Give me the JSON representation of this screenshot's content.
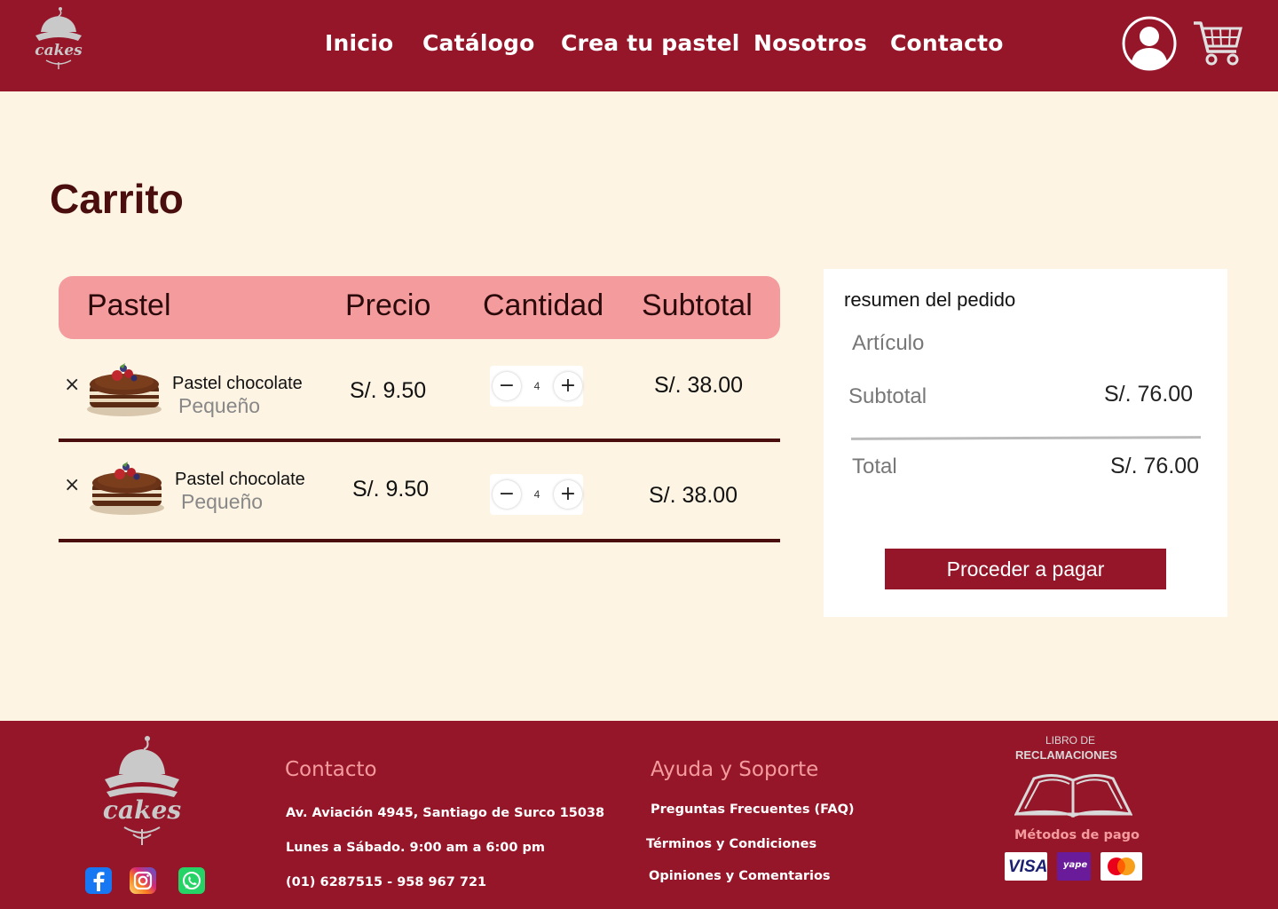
{
  "brand": {
    "logo_text": "cakes"
  },
  "nav": {
    "items": [
      {
        "label": "Inicio"
      },
      {
        "label": "Catálogo"
      },
      {
        "label": "Crea tu pastel"
      },
      {
        "label": "Nosotros"
      },
      {
        "label": "Contacto"
      }
    ]
  },
  "page": {
    "title": "Carrito"
  },
  "cart": {
    "columns": [
      "Pastel",
      "Precio",
      "Cantidad",
      "Subtotal"
    ],
    "items": [
      {
        "name": "Pastel chocolate",
        "size": "Pequeño",
        "price": "S/. 9.50",
        "quantity": "4",
        "subtotal": "S/. 38.00",
        "remove": "×"
      },
      {
        "name": "Pastel chocolate",
        "size": "Pequeño",
        "price": "S/. 9.50",
        "quantity": "4",
        "subtotal": "S/. 38.00",
        "remove": "×"
      }
    ],
    "minus": "−",
    "plus": "+"
  },
  "summary": {
    "title": "resumen del pedido",
    "article_label": "Artículo",
    "subtotal_label": "Subtotal",
    "subtotal_value": "S/. 76.00",
    "total_label": "Total",
    "total_value": "S/. 76.00",
    "checkout_label": "Proceder a pagar"
  },
  "footer": {
    "contact": {
      "heading": "Contacto",
      "address": "Av. Aviación 4945, Santiago de Surco 15038",
      "hours": "Lunes a Sábado. 9:00 am a 6:00 pm",
      "phones": "(01) 6287515 - 958 967 721"
    },
    "support": {
      "heading": "Ayuda y Soporte",
      "links": [
        "Preguntas Frecuentes (FAQ)",
        "Términos y Condiciones",
        "Opiniones y Comentarios"
      ]
    },
    "libro": {
      "line1": "LIBRO DE",
      "line2": "RECLAMACIONES"
    },
    "payments": {
      "label": "Métodos de pago",
      "visa": "VISA",
      "yape": "yape"
    },
    "social": [
      "facebook-icon",
      "instagram-icon",
      "whatsapp-icon"
    ]
  },
  "colors": {
    "primary": "#951529",
    "accent": "#f49b9d",
    "background": "#fdf4e3",
    "dark": "#4a0e0e"
  }
}
